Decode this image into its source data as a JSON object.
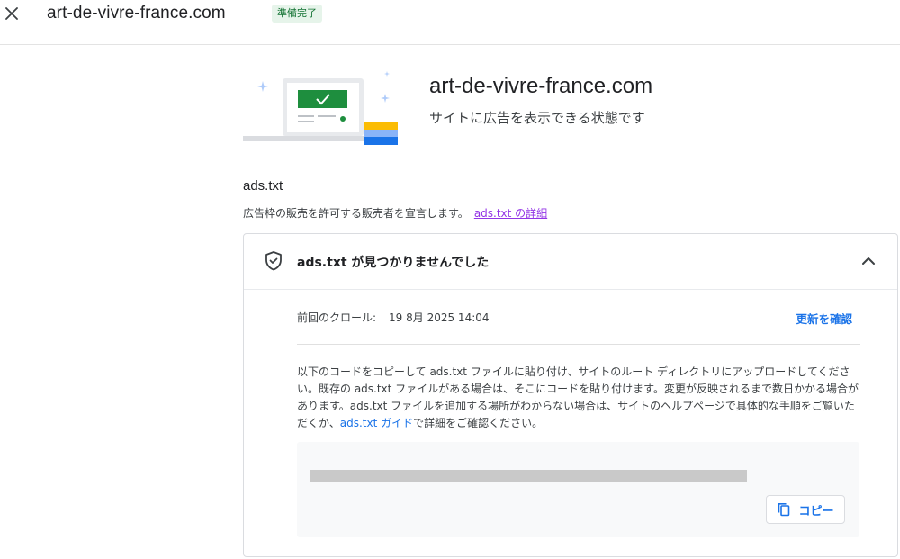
{
  "header": {
    "title": "art-de-vivre-france.com",
    "status_badge": "準備完了"
  },
  "hero": {
    "title": "art-de-vivre-france.com",
    "subtitle": "サイトに広告を表示できる状態です"
  },
  "ads_section": {
    "title": "ads.txt",
    "description": "広告枠の販売を許可する販売者を宣言します。",
    "details_link": "ads.txt の詳細"
  },
  "panel": {
    "title": "ads.txt が見つかりませんでした",
    "crawl_label": "前回のクロール:",
    "crawl_value": "19 8月 2025 14:04",
    "check_update": "更新を確認",
    "instructions_pre": "以下のコードをコピーして ads.txt ファイルに貼り付け、サイトのルート ディレクトリにアップロードしてください。既存の ads.txt ファイルがある場合は、そこにコードを貼り付けます。変更が反映されるまで数日かかる場合があります。ads.txt ファイルを追加する場所がわからない場合は、サイトのヘルプページで具体的な手順をご覧いただくか、",
    "guide_link": "ads.txt ガイド",
    "instructions_post": "で詳細をご確認ください。",
    "copy_label": "コピー"
  },
  "colors": {
    "accent": "#1a73e8",
    "visited_link": "#9334e6",
    "success_bg": "#e6f4ea",
    "success_text": "#137333",
    "illustration_green": "#1e8e3e",
    "illustration_yellow": "#fbbc04"
  },
  "icons": {
    "close": "close-icon",
    "shield": "shield-check-icon",
    "chevron": "chevron-up-icon",
    "copy": "copy-icon"
  }
}
